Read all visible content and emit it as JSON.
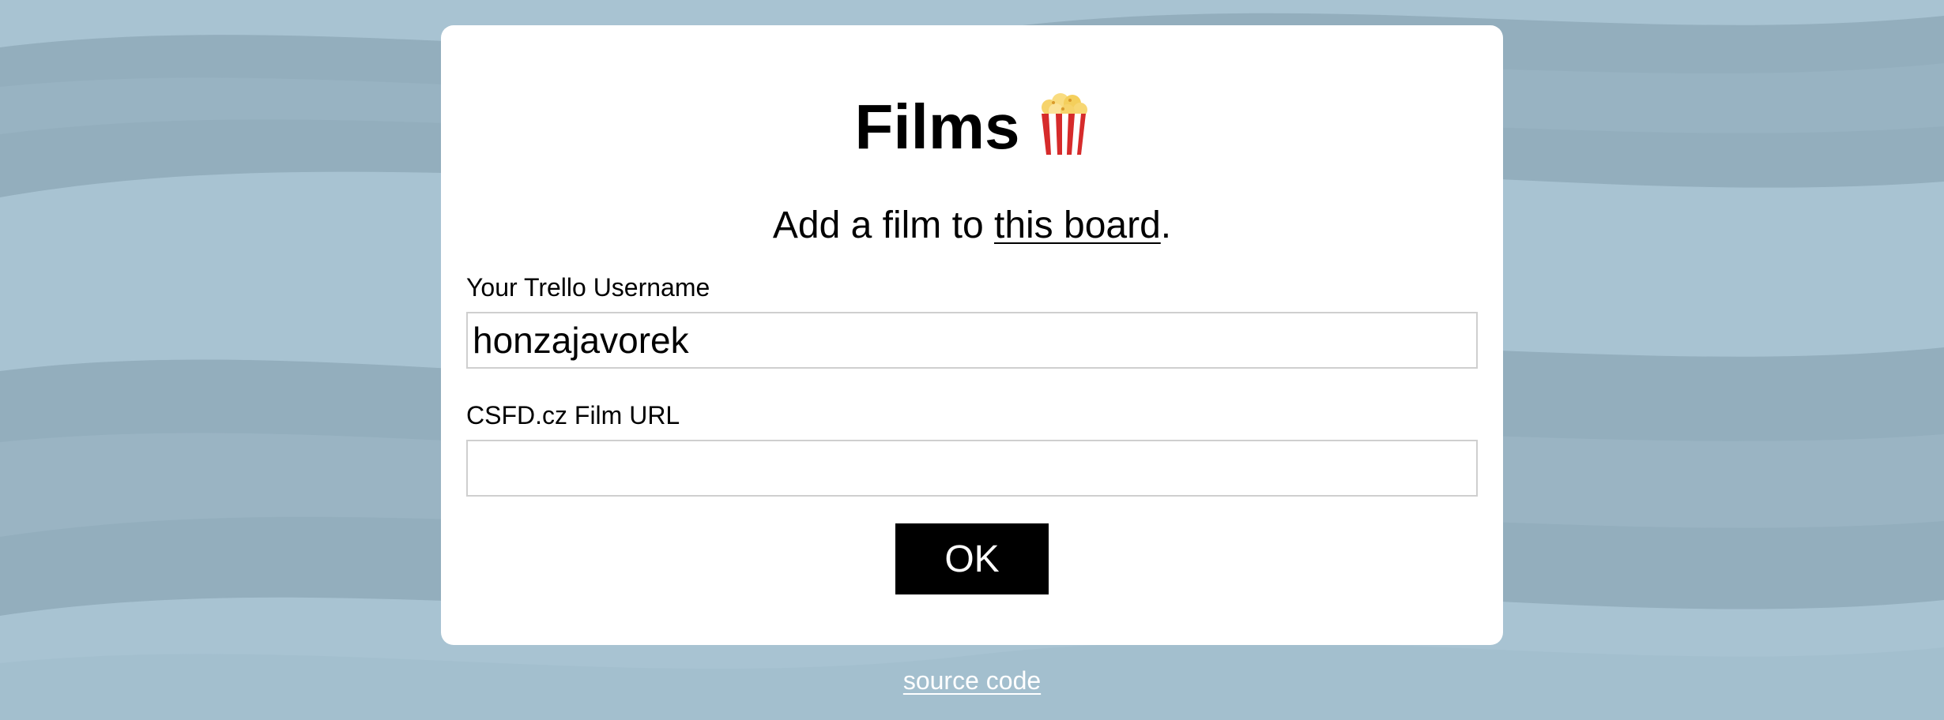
{
  "app": {
    "title": "Films",
    "title_icon": "popcorn-icon"
  },
  "intro": {
    "text_before": "Add a film to ",
    "link_text": "this board",
    "text_after": "."
  },
  "form": {
    "username_label": "Your Trello Username",
    "username_value": "honzajavorek",
    "film_url_label": "CSFD.cz Film URL",
    "film_url_value": "",
    "submit_label": "OK"
  },
  "footer": {
    "source_link": "source code"
  },
  "colors": {
    "background": "#a6c1d0",
    "card": "#ffffff",
    "button": "#000000",
    "button_text": "#ffffff",
    "link_footer": "#ffffff"
  }
}
